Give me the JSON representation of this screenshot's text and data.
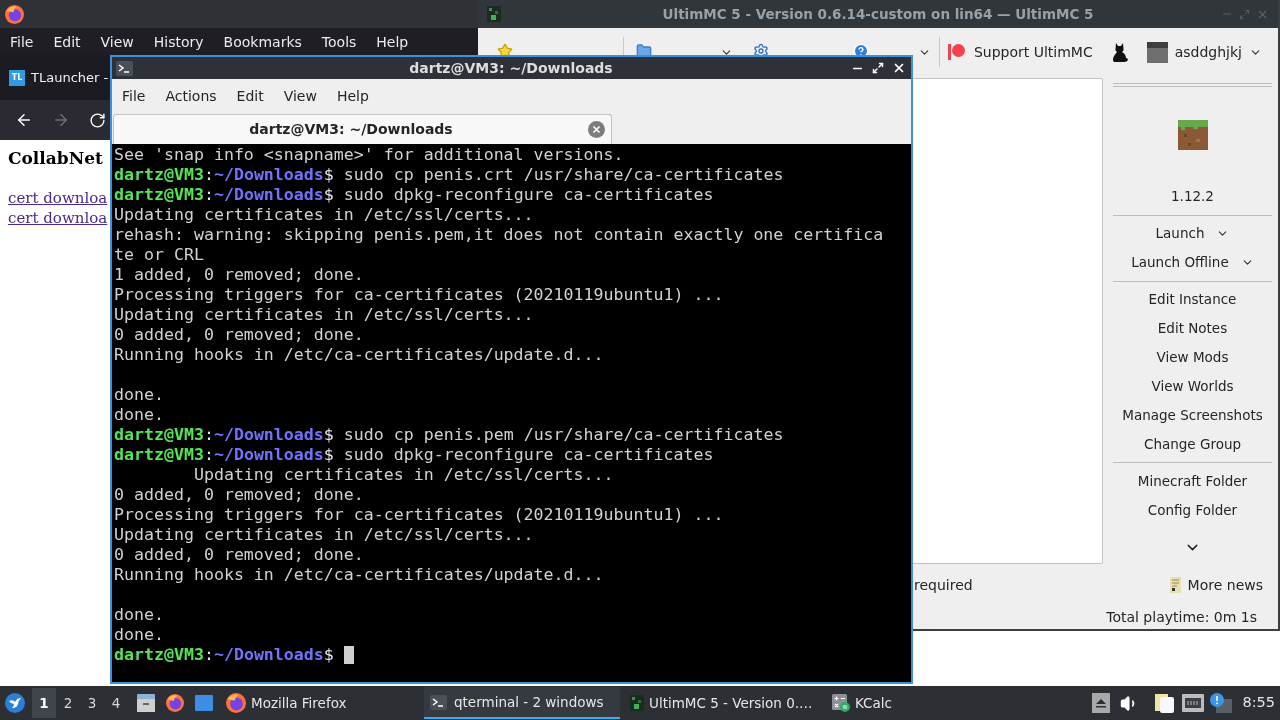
{
  "browser": {
    "menu": [
      "File",
      "Edit",
      "View",
      "History",
      "Bookmarks",
      "Tools",
      "Help"
    ],
    "tab": {
      "favicon": "TL",
      "title": "TLauncher -"
    },
    "page": {
      "heading": "CollabNet",
      "links": [
        "cert downloa",
        "cert downloa"
      ]
    }
  },
  "launcher": {
    "title": "UltimMC 5 - Version 0.6.14-custom on lin64 — UltimMC 5",
    "toolbar": [
      {
        "kind": "add",
        "dropdown": false
      },
      {
        "kind": "folder",
        "dropdown": true
      },
      {
        "kind": "settings",
        "dropdown": false
      },
      {
        "kind": "help",
        "dropdown": true
      }
    ],
    "support": "Support UltimMC",
    "account": "asddghjkj",
    "instance": {
      "version": "1.12.2",
      "launch": [
        "Launch",
        "Launch Offline"
      ],
      "actions": [
        "Edit Instance",
        "Edit Notes",
        "View Mods",
        "View Worlds",
        "Manage Screenshots",
        "Change Group"
      ],
      "folders": [
        "Minecraft Folder",
        "Config Folder"
      ]
    },
    "news": {
      "text": "required",
      "more": "More news"
    },
    "playtime": "Total playtime: 0m 1s"
  },
  "terminal": {
    "title": "dartz@VM3: ~/Downloads",
    "menu": [
      "File",
      "Actions",
      "Edit",
      "View",
      "Help"
    ],
    "tabs": [
      {
        "label": "dartz@VM3: ~/Downloads",
        "selected": true
      }
    ],
    "lines": [
      {
        "kind": "output",
        "text": "See 'snap info <snapname>' for additional versions."
      },
      {
        "kind": "prompt",
        "user": "dartz@VM3",
        "colon": ":",
        "path": "~/Downloads",
        "sign": "$",
        "command": "sudo cp penis.crt /usr/share/ca-certificates",
        "cursor": false
      },
      {
        "kind": "prompt",
        "user": "dartz@VM3",
        "colon": ":",
        "path": "~/Downloads",
        "sign": "$",
        "command": "sudo dpkg-reconfigure ca-certificates",
        "cursor": false
      },
      {
        "kind": "output",
        "text": "Updating certificates in /etc/ssl/certs..."
      },
      {
        "kind": "output",
        "text": "rehash: warning: skipping penis.pem,it does not contain exactly one certifica"
      },
      {
        "kind": "output",
        "text": "te or CRL"
      },
      {
        "kind": "output",
        "text": "1 added, 0 removed; done."
      },
      {
        "kind": "output",
        "text": "Processing triggers for ca-certificates (20210119ubuntu1) ..."
      },
      {
        "kind": "output",
        "text": "Updating certificates in /etc/ssl/certs..."
      },
      {
        "kind": "output",
        "text": "0 added, 0 removed; done."
      },
      {
        "kind": "output",
        "text": "Running hooks in /etc/ca-certificates/update.d..."
      },
      {
        "kind": "blank"
      },
      {
        "kind": "output",
        "text": "done."
      },
      {
        "kind": "output",
        "text": "done."
      },
      {
        "kind": "prompt",
        "user": "dartz@VM3",
        "colon": ":",
        "path": "~/Downloads",
        "sign": "$",
        "command": "sudo cp penis.pem /usr/share/ca-certificates",
        "cursor": false
      },
      {
        "kind": "prompt",
        "user": "dartz@VM3",
        "colon": ":",
        "path": "~/Downloads",
        "sign": "$",
        "command": "sudo dpkg-reconfigure ca-certificates",
        "cursor": false
      },
      {
        "kind": "output",
        "text": "        Updating certificates in /etc/ssl/certs..."
      },
      {
        "kind": "output",
        "text": "0 added, 0 removed; done."
      },
      {
        "kind": "output",
        "text": "Processing triggers for ca-certificates (20210119ubuntu1) ..."
      },
      {
        "kind": "output",
        "text": "Updating certificates in /etc/ssl/certs..."
      },
      {
        "kind": "output",
        "text": "0 added, 0 removed; done."
      },
      {
        "kind": "output",
        "text": "Running hooks in /etc/ca-certificates/update.d..."
      },
      {
        "kind": "blank"
      },
      {
        "kind": "output",
        "text": "done."
      },
      {
        "kind": "output",
        "text": "done."
      },
      {
        "kind": "prompt",
        "user": "dartz@VM3",
        "colon": ":",
        "path": "~/Downloads",
        "sign": "$",
        "cursor": true
      }
    ]
  },
  "taskbar": {
    "workspaces": [
      {
        "label": "1",
        "selected": true
      },
      {
        "label": "2",
        "selected": false
      },
      {
        "label": "3",
        "selected": false
      },
      {
        "label": "4",
        "selected": false
      }
    ],
    "tasks": [
      {
        "kind": "browser",
        "label": "Mozilla Firefox",
        "selected": false
      },
      {
        "kind": "terminal",
        "label": "qterminal - 2 windows",
        "selected": true
      },
      {
        "kind": "launcher",
        "label": "UltimMC 5 - Version 0.…",
        "selected": false
      },
      {
        "kind": "calculator",
        "label": "KCalc",
        "selected": false
      }
    ],
    "clock": "8:55"
  }
}
